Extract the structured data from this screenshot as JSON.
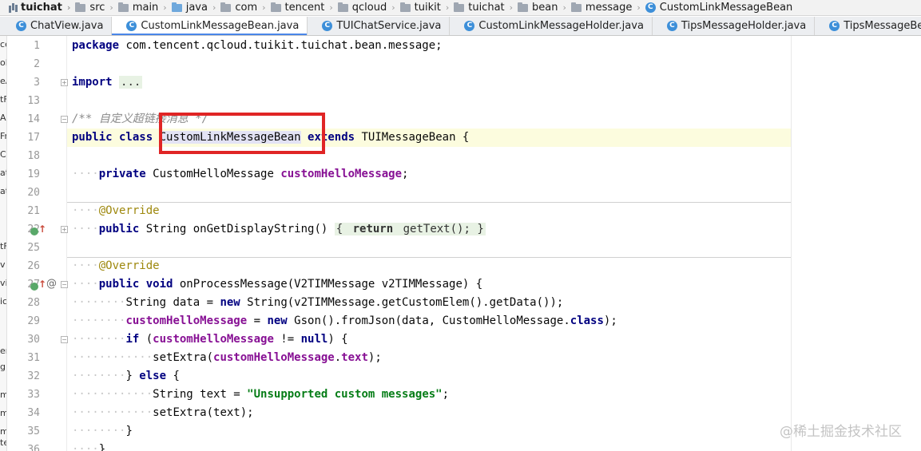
{
  "breadcrumb": [
    {
      "label": "tuichat",
      "icon": "module-icon"
    },
    {
      "label": "src",
      "icon": "folder-icon"
    },
    {
      "label": "main",
      "icon": "folder-icon"
    },
    {
      "label": "java",
      "icon": "folder-icon"
    },
    {
      "label": "com",
      "icon": "folder-icon"
    },
    {
      "label": "tencent",
      "icon": "folder-icon"
    },
    {
      "label": "qcloud",
      "icon": "folder-icon"
    },
    {
      "label": "tuikit",
      "icon": "folder-icon"
    },
    {
      "label": "tuichat",
      "icon": "folder-icon"
    },
    {
      "label": "bean",
      "icon": "folder-icon"
    },
    {
      "label": "message",
      "icon": "folder-icon"
    },
    {
      "label": "CustomLinkMessageBean",
      "icon": "class-icon"
    }
  ],
  "tabs": [
    {
      "label": "ChatView.java",
      "active": false
    },
    {
      "label": "CustomLinkMessageBean.java",
      "active": true
    },
    {
      "label": "TUIChatService.java",
      "active": false
    },
    {
      "label": "CustomLinkMessageHolder.java",
      "active": false
    },
    {
      "label": "TipsMessageHolder.java",
      "active": false
    },
    {
      "label": "TipsMessageBean.java",
      "active": false
    }
  ],
  "left_panel_fragments": [
    "ce",
    "ol",
    "eA",
    "tF",
    "Ac",
    "Fr",
    "Ch",
    "at",
    "at",
    "",
    "",
    "",
    "tF",
    "v",
    "vi",
    "ic",
    "",
    "",
    "er",
    "gN",
    "m",
    "m",
    "m",
    "te",
    "es"
  ],
  "line_numbers": [
    "1",
    "2",
    "3",
    "13",
    "14",
    "17",
    "18",
    "19",
    "20",
    "21",
    "22",
    "25",
    "26",
    "27",
    "28",
    "29",
    "30",
    "31",
    "32",
    "33",
    "34",
    "35",
    "36"
  ],
  "code": {
    "l1_kw": "package",
    "l1_rest": " com.tencent.qcloud.tuikit.tuichat.bean.message;",
    "l3_kw": "import",
    "l3_folded": "...",
    "l14_comment": "/** 自定义超链接消息 */",
    "l17_kw": "public class",
    "l17_class": "CustomLinkMessageBean",
    "l17_kw2": "extends",
    "l17_rest": " TUIMessageBean {",
    "l19_kw": "private",
    "l19_type": " CustomHelloMessage ",
    "l19_field": "customHelloMessage",
    "l19_end": ";",
    "l21_ann": "@Override",
    "l22_kw": "public",
    "l22_sig": " String onGetDisplayString() ",
    "l22_body_open": "{ ",
    "l22_return": "return",
    "l22_body": " getText(); }",
    "l26_ann": "@Override",
    "l27_kw": "public void",
    "l27_sig": " onProcessMessage(V2TIMMessage v2TIMMessage) {",
    "l28_pre": "String data = ",
    "l28_kw": "new",
    "l28_rest": " String(v2TIMMessage.getCustomElem().getData());",
    "l29_field": "customHelloMessage",
    "l29_mid": " = ",
    "l29_kw": "new",
    "l29_mid2": " Gson().fromJson(data, CustomHelloMessage.",
    "l29_kw2": "class",
    "l29_end": ");",
    "l30_kw": "if",
    "l30_open": " (",
    "l30_field": "customHelloMessage",
    "l30_mid": " != ",
    "l30_null": "null",
    "l30_end": ") {",
    "l31_pre": "setExtra(",
    "l31_field": "customHelloMessage",
    "l31_dot": ".",
    "l31_field2": "text",
    "l31_end": ");",
    "l32_pre": "} ",
    "l32_kw": "else",
    "l32_end": " {",
    "l33_pre": "String text = ",
    "l33_str": "\"Unsupported custom messages\"",
    "l33_end": ";",
    "l34_text": "setExtra(text);",
    "l35_text": "}",
    "l36_text": "}"
  },
  "watermark": "@稀土掘金技术社区",
  "colors": {
    "keyword": "#000080",
    "field": "#871094",
    "string": "#067d17",
    "annotation": "#9e880d",
    "comment": "#8c8c8c",
    "highlight_box": "#e02525",
    "active_tab_underline": "#4a86e8",
    "caret_row": "#fcfcde"
  }
}
